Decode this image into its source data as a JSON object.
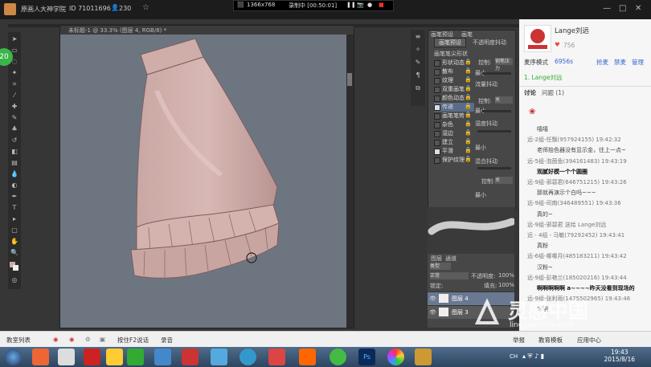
{
  "app": {
    "title": "原画人大神学院",
    "id_text": "ID 71011696",
    "followers": "230"
  },
  "recorder": {
    "resolution": "1366x768",
    "status": "录制中 [00:50:01]"
  },
  "photoshop": {
    "doc_tab": "未标题-1 @ 33.3% (图层 4, RGB/8) *",
    "brush_panel": {
      "tabs": [
        "画笔预设",
        "画笔"
      ],
      "preset_button": "画笔预设",
      "list_title": "画笔笔尖形状",
      "items": [
        "形状动态",
        "散布",
        "纹理",
        "双重画笔",
        "颜色动态",
        "传递",
        "画笔笔势",
        "杂色",
        "湿边",
        "建立",
        "平滑",
        "保护纹理"
      ],
      "checked": [
        "传递",
        "平滑"
      ],
      "opacity_label": "不透明度抖动",
      "control_label": "控制:",
      "control_value": "钢笔压力",
      "min_label": "最小",
      "flow_label": "流量抖动",
      "off_value": "关",
      "wetness_label": "湿度抖动",
      "mix_label": "混合抖动"
    },
    "layers_panel": {
      "tabs": [
        "图层",
        "通道"
      ],
      "kind": "类型",
      "blend_mode": "正常",
      "opacity_label": "不透明度:",
      "opacity_value": "100%",
      "fill_label": "填充:",
      "fill_value": "100%",
      "lock_label": "锁定:",
      "layers": [
        "图层 4",
        "图层 3"
      ]
    },
    "badge": "20"
  },
  "chat": {
    "username": "Lange刘远",
    "likes": "756",
    "mode_label": "麦序模式",
    "count": "6956s",
    "actions": [
      "抢麦",
      "禁麦",
      "管理"
    ],
    "speaker": "1. Lange刘远",
    "tabs": [
      "讨论",
      "问题 (1)"
    ],
    "messages": [
      {
        "text": "嘻嘻",
        "style": "normal"
      },
      {
        "text": "远-2组-任飘(957924155) 19:42:32",
        "style": "grey"
      },
      {
        "text": "老师抬色器没有显示金，往上一点~",
        "style": "normal"
      },
      {
        "text": "远-5组-泡茵鱼(394161483) 19:43:19",
        "style": "grey"
      },
      {
        "text": "观腻好模一个个圆圈",
        "style": "bold"
      },
      {
        "text": "远-9组-邪碧君(646751215) 19:43:26",
        "style": "grey"
      },
      {
        "text": "那就再演示个白吗~~~",
        "style": "normal"
      },
      {
        "text": "远-9组-司南(346489551) 19:43:36",
        "style": "grey"
      },
      {
        "text": "真的~",
        "style": "normal"
      },
      {
        "text": "远-9组-邪碧君 送给 Lange刘远",
        "style": "grey"
      },
      {
        "text": "远 - 4组 - 马敏(79292452) 19:43:41",
        "style": "grey"
      },
      {
        "text": "真粉",
        "style": "normal"
      },
      {
        "text": "远-6组-哪哪月(485183211) 19:43:42",
        "style": "grey"
      },
      {
        "text": "汉粉~",
        "style": "normal"
      },
      {
        "text": "远-9组-彭艳兰(185020216) 19:43:44",
        "style": "grey"
      },
      {
        "text": "啊啊啊啊啊 a~~~~昨天没看到现场的",
        "style": "bold"
      },
      {
        "text": "远-9组-张利雨(1475502965) 19:43:46",
        "style": "grey"
      },
      {
        "text": "好哦",
        "style": "normal"
      }
    ]
  },
  "statusbar": {
    "items": [
      "教室列表",
      "按住F2说话",
      "录音"
    ],
    "right_items": [
      "举报",
      "教育模板",
      "应用中心"
    ]
  },
  "taskbar": {
    "time": "19:43",
    "date": "2015/8/16",
    "lang": "CH"
  },
  "watermark": {
    "cn": "灵感中国",
    "en": "lingganchina.com"
  }
}
